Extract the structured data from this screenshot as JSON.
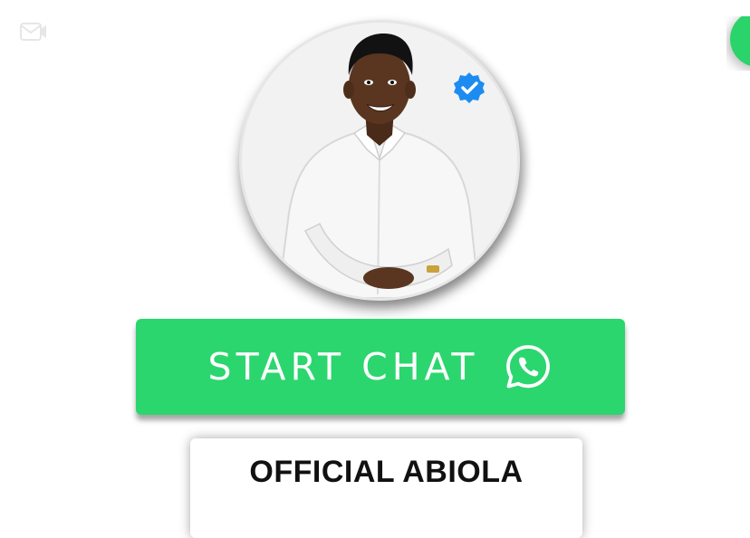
{
  "cta": {
    "label": "START CHAT",
    "icon": "whatsapp-icon",
    "color": "#2cd66e"
  },
  "profile": {
    "name": "OFFICIAL ABIOLA",
    "verified": true,
    "verified_color": "#1d8cf0"
  },
  "colors": {
    "background": "#ffffff",
    "accent": "#2bd46a"
  }
}
